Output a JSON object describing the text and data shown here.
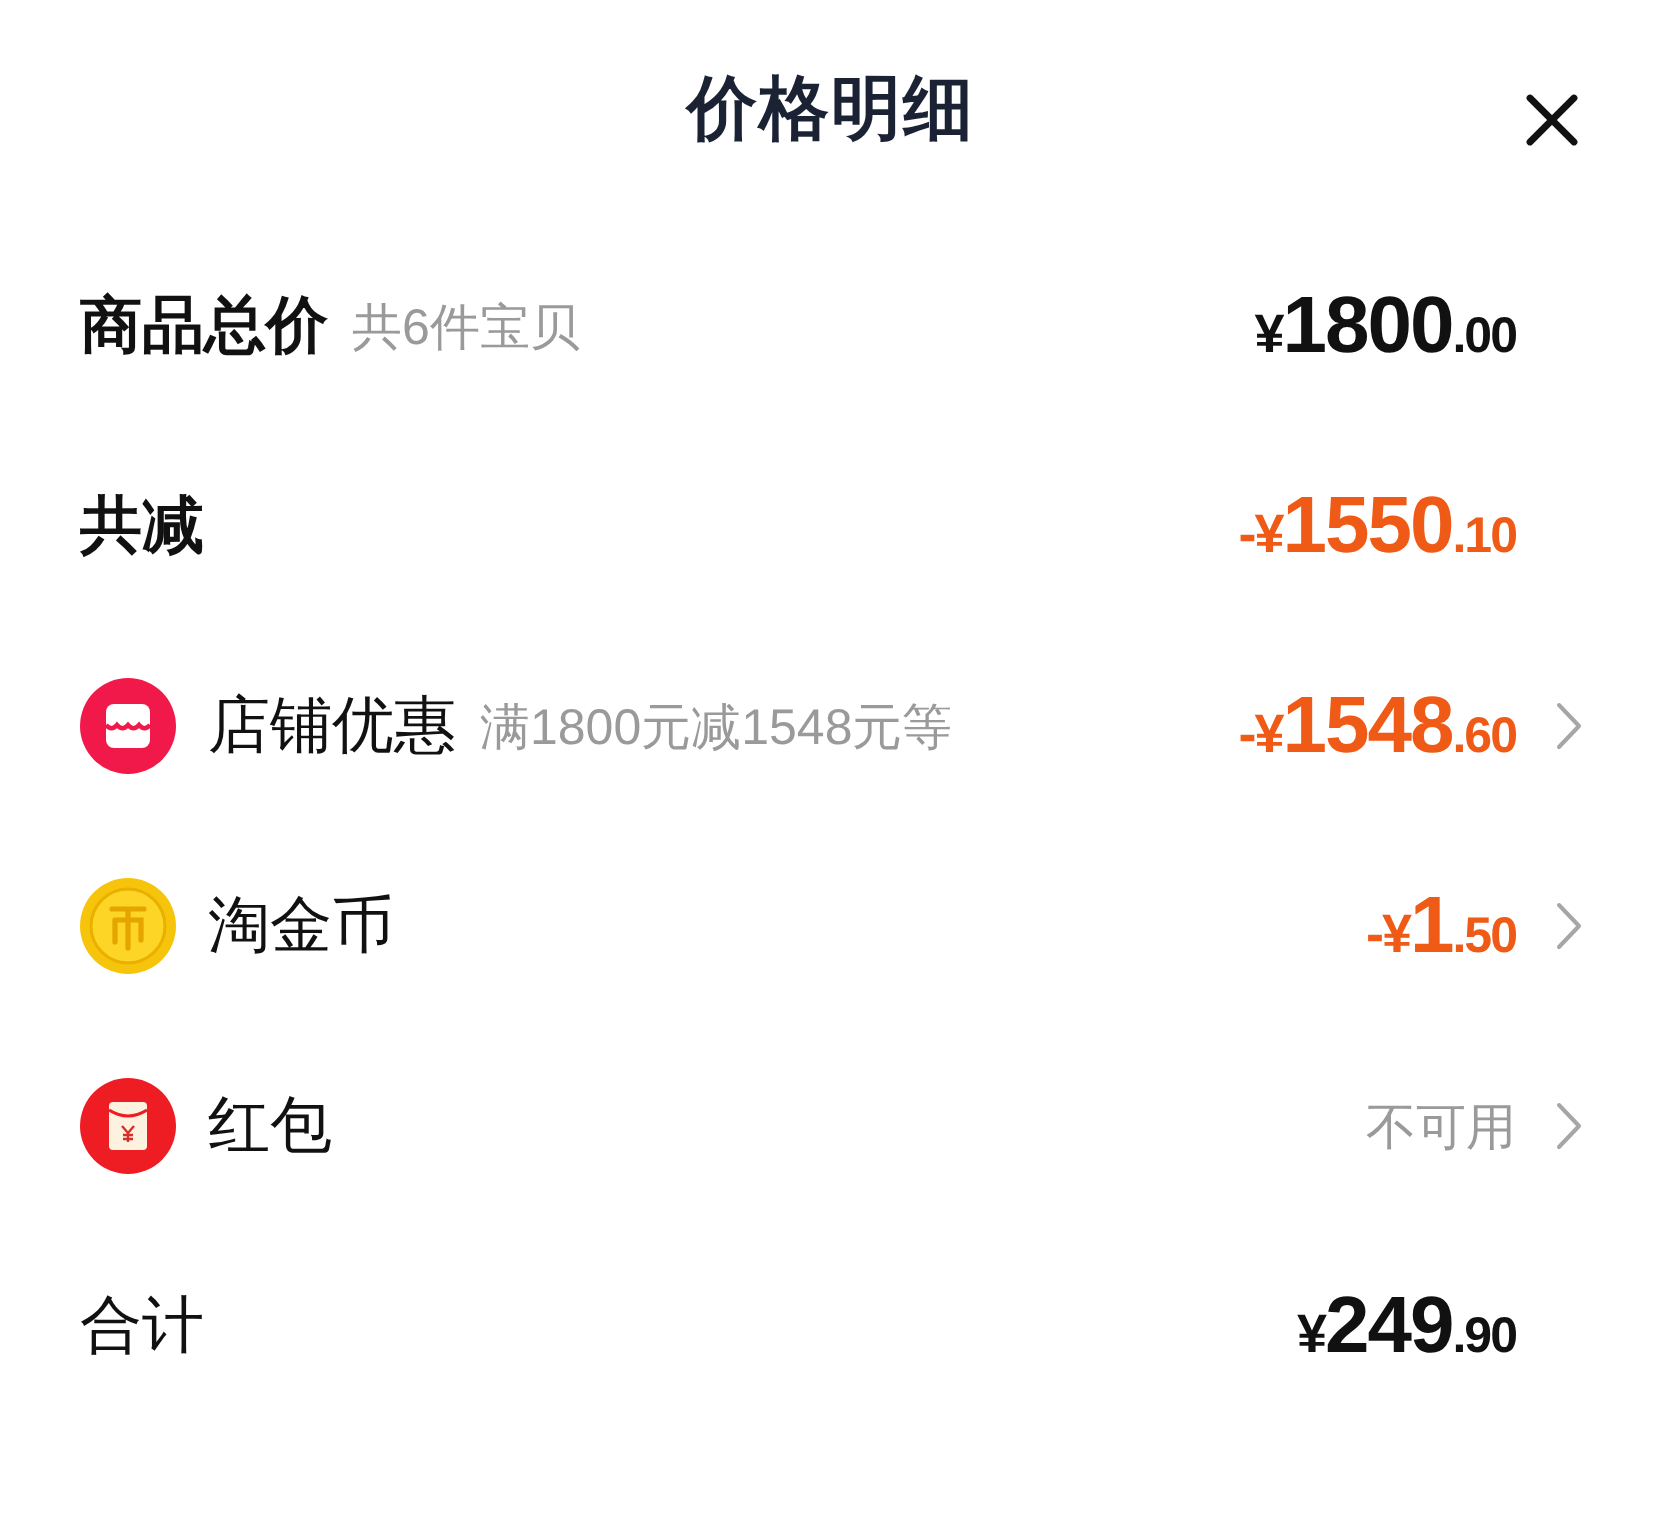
{
  "header": {
    "title": "价格明细"
  },
  "rows": [
    {
      "kind": "summary",
      "label": "商品总价",
      "strong": true,
      "note": "共6件宝贝",
      "amount": "¥1800.00",
      "discount": false
    },
    {
      "kind": "summary",
      "label": "共减",
      "strong": true,
      "amount": "-¥1550.10",
      "discount": true
    },
    {
      "kind": "shop",
      "label": "店铺优惠",
      "note": "满1800元减1548元等",
      "amount": "-¥1548.60",
      "discount": true
    },
    {
      "kind": "coin",
      "label": "淘金币",
      "amount": "-¥1.50",
      "discount": true
    },
    {
      "kind": "envelope",
      "label": "红包",
      "status": "不可用"
    },
    {
      "kind": "summary",
      "label": "合计",
      "strong": false,
      "amount": "¥249.90",
      "discount": false
    }
  ]
}
